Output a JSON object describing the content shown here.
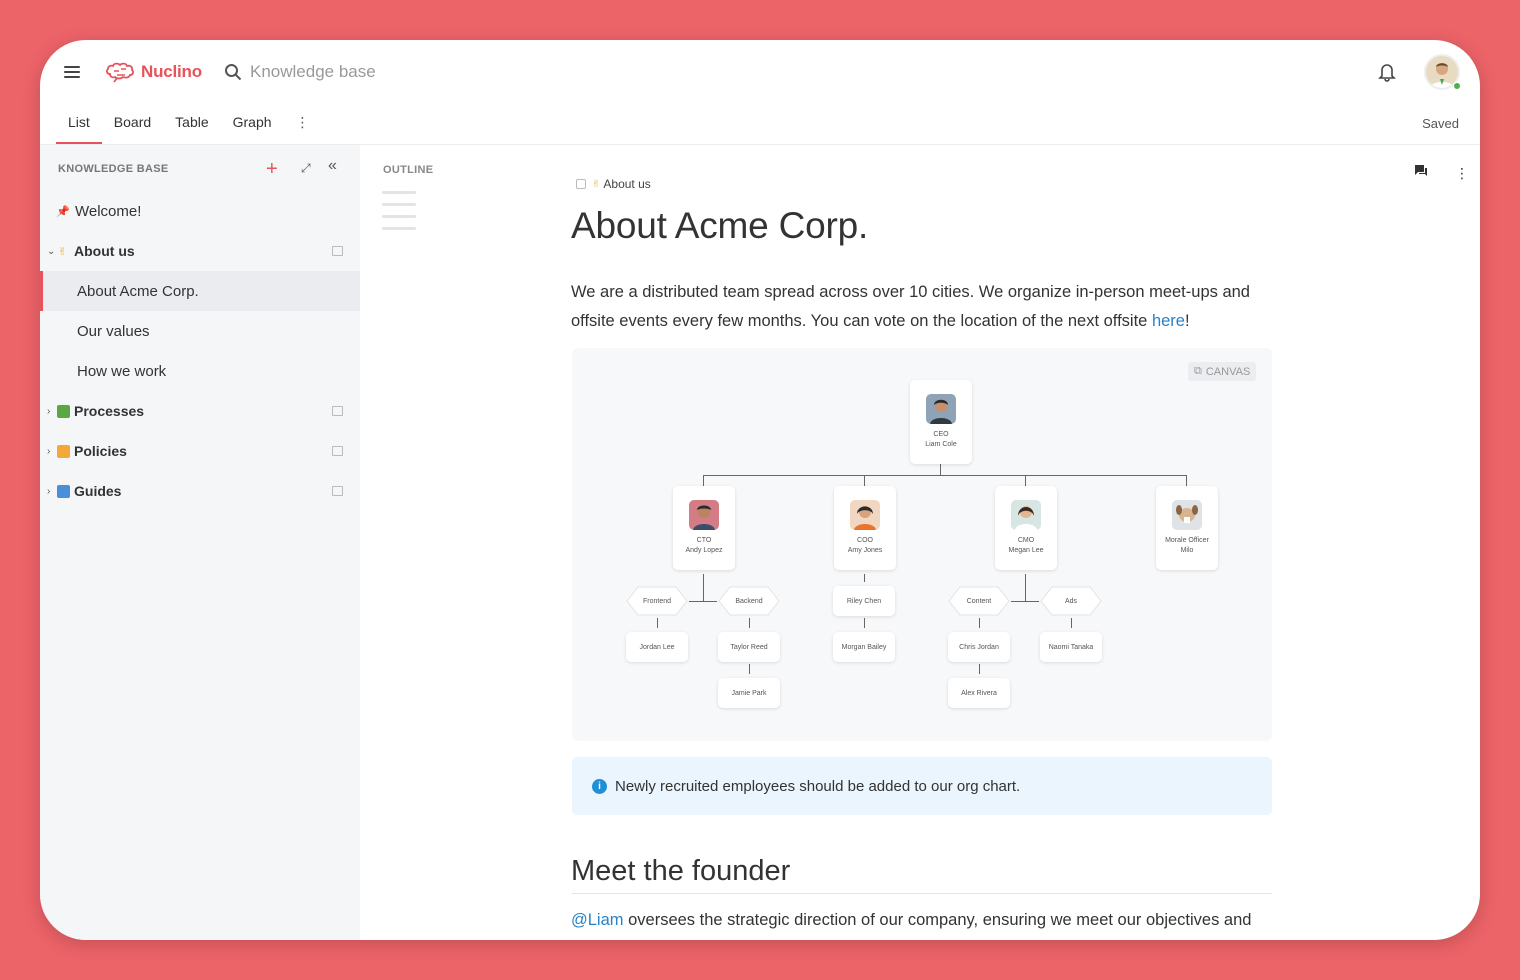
{
  "app": {
    "name": "Nuclino"
  },
  "search": {
    "placeholder": "Knowledge base"
  },
  "views": {
    "tabs": [
      "List",
      "Board",
      "Table",
      "Graph"
    ],
    "active": "List",
    "more": "⋮",
    "status": "Saved"
  },
  "sidebar": {
    "header": "KNOWLEDGE BASE",
    "add_label": "+",
    "collapse_label": "«",
    "items": [
      {
        "label": "Welcome!",
        "icon": "pin-icon"
      },
      {
        "label": "About us",
        "icon": "victory-hand-emoji",
        "expanded": true
      },
      {
        "label": "About Acme Corp.",
        "selected": true
      },
      {
        "label": "Our values"
      },
      {
        "label": "How we work"
      },
      {
        "label": "Processes",
        "icon": "green-book-emoji"
      },
      {
        "label": "Policies",
        "icon": "orange-book-emoji"
      },
      {
        "label": "Guides",
        "icon": "blue-book-emoji"
      }
    ]
  },
  "outline": {
    "label": "OUTLINE"
  },
  "document": {
    "breadcrumb": "About us",
    "title": "About Acme Corp.",
    "intro_before_link": "We are a distributed team spread across over 10 cities. We organize in-person meet-ups and offsite events every few months. You can vote on the location of the next offsite ",
    "intro_link": "here",
    "intro_after_link": "!",
    "canvas_badge": "CANVAS",
    "org": {
      "ceo": {
        "role": "CEO",
        "name": "Liam Cole"
      },
      "cto": {
        "role": "CTO",
        "name": "Andy Lopez"
      },
      "coo": {
        "role": "COO",
        "name": "Amy Jones"
      },
      "cmo": {
        "role": "CMO",
        "name": "Megan Lee"
      },
      "morale": {
        "role": "Morale Officer",
        "name": "Milo"
      },
      "frontend": "Frontend",
      "backend": "Backend",
      "content": "Content",
      "ads": "Ads",
      "riley": "Riley Chen",
      "jordan": "Jordan Lee",
      "taylor": "Taylor Reed",
      "jamie": "Jamie Park",
      "morgan": "Morgan Bailey",
      "chris": "Chris Jordan",
      "naomi": "Naomi Tanaka",
      "alex": "Alex Rivera"
    },
    "callout": "Newly recruited employees should be added to our org chart.",
    "section_title": "Meet the founder",
    "founder_mention": "@Liam",
    "founder_text": " oversees the strategic direction of our company, ensuring we meet our objectives and"
  },
  "colors": {
    "accent": "#e8535b",
    "background": "#ec6368",
    "link": "#2a82c6",
    "info": "#1f8fd6"
  }
}
